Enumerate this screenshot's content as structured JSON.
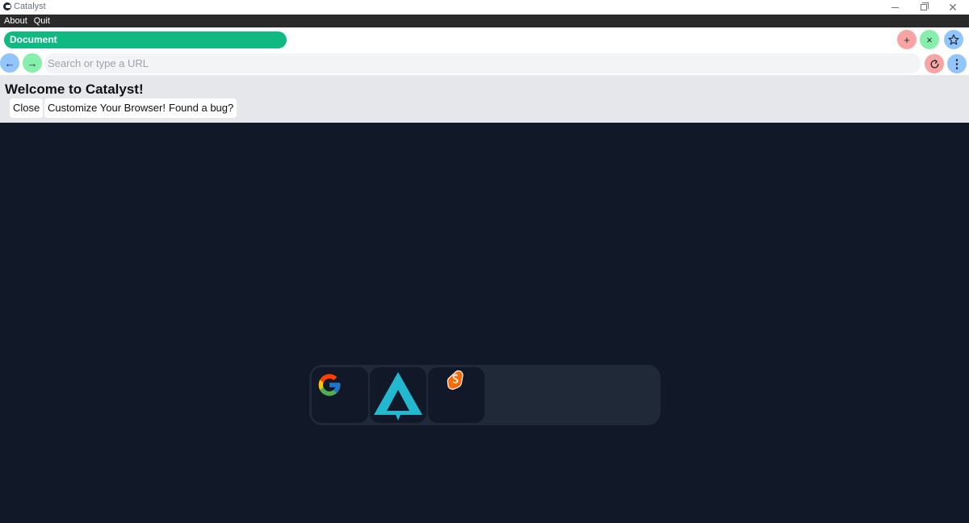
{
  "window": {
    "title": "Catalyst"
  },
  "menu": {
    "items": [
      "About",
      "Quit"
    ]
  },
  "tabs": [
    {
      "label": "Document",
      "color": "#10b981"
    }
  ],
  "toolbar": {
    "add_icon": "+",
    "close_icon": "×",
    "back_icon": "←",
    "forward_icon": "→",
    "menu_icon": "⋮"
  },
  "address_bar": {
    "placeholder": "Search or type a URL",
    "value": ""
  },
  "welcome": {
    "title": "Welcome to Catalyst!",
    "buttons": [
      "Close",
      "Customize Your Browser!",
      "Found a bug?"
    ]
  },
  "shortcuts": [
    {
      "name": "google",
      "icon": "google-logo-icon"
    },
    {
      "name": "arc",
      "icon": "triangle-logo-icon"
    },
    {
      "name": "svelte",
      "icon": "svelte-logo-icon"
    }
  ],
  "colors": {
    "background": "#111827",
    "dock": "#1f2937",
    "tab": "#10b981",
    "pink_button": "#f9a3a3",
    "green_button": "#86efac",
    "blue_button": "#93c5fd"
  }
}
